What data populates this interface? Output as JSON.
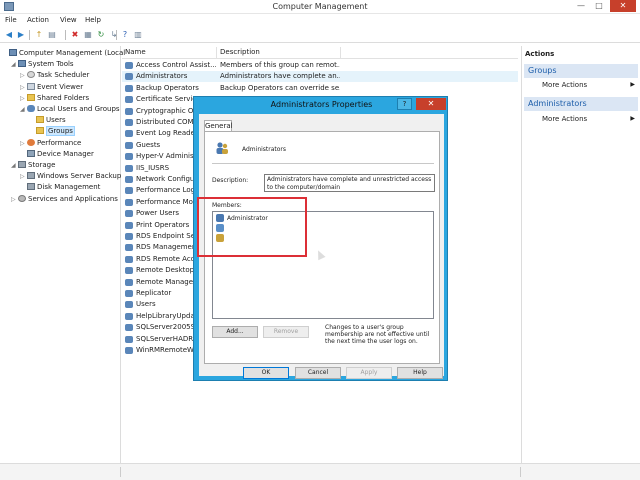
{
  "window": {
    "title": "Computer Management",
    "minimize": "—",
    "maximize": "□",
    "close": "✕"
  },
  "menu": [
    "File",
    "Action",
    "View",
    "Help"
  ],
  "toolbar": {
    "icons": [
      "back-arrow-icon",
      "forward-arrow-icon",
      "up-folder-icon",
      "show-hide-tree-icon",
      "delete-icon",
      "properties-icon",
      "refresh-icon",
      "export-list-icon",
      "help-icon",
      "show-hide-action-pane-icon"
    ],
    "glyphs": [
      "◀",
      "▶",
      "↑",
      "▤",
      "✖",
      "▦",
      "↻",
      "↳",
      "?",
      "▥"
    ],
    "colors": [
      "#2c7fc7",
      "#2c7fc7",
      "#c79a2c",
      "#6b7f94",
      "#d12a2a",
      "#6b7f94",
      "#2c8b3c",
      "#6b7f94",
      "#2c5fb3",
      "#6b7f94"
    ]
  },
  "tree": [
    {
      "label": "Computer Management (Local",
      "icon": "computer-icon",
      "cls": "ico-comp",
      "exp": "",
      "level": 0
    },
    {
      "label": "System Tools",
      "icon": "tools-icon",
      "cls": "ico-comp",
      "exp": "◢",
      "level": 1
    },
    {
      "label": "Task Scheduler",
      "icon": "task-scheduler-icon",
      "cls": "ico-clock",
      "exp": "▷",
      "level": 2
    },
    {
      "label": "Event Viewer",
      "icon": "event-viewer-icon",
      "cls": "ico-log",
      "exp": "▷",
      "level": 2
    },
    {
      "label": "Shared Folders",
      "icon": "shared-folders-icon",
      "cls": "ico-folder",
      "exp": "▷",
      "level": 2
    },
    {
      "label": "Local Users and Groups",
      "icon": "users-groups-icon",
      "cls": "ico-users",
      "exp": "◢",
      "level": 2
    },
    {
      "label": "Users",
      "icon": "folder-icon",
      "cls": "ico-folder",
      "exp": "",
      "level": 3
    },
    {
      "label": "Groups",
      "icon": "folder-icon",
      "cls": "ico-folder",
      "exp": "",
      "level": 3,
      "selected": true
    },
    {
      "label": "Performance",
      "icon": "performance-icon",
      "cls": "ico-perf",
      "exp": "▷",
      "level": 2
    },
    {
      "label": "Device Manager",
      "icon": "device-manager-icon",
      "cls": "ico-dev",
      "exp": "",
      "level": 2
    },
    {
      "label": "Storage",
      "icon": "storage-icon",
      "cls": "ico-disk",
      "exp": "◢",
      "level": 1
    },
    {
      "label": "Windows Server Backup",
      "icon": "backup-icon",
      "cls": "ico-disk",
      "exp": "▷",
      "level": 2
    },
    {
      "label": "Disk Management",
      "icon": "disk-management-icon",
      "cls": "ico-disk",
      "exp": "",
      "level": 2
    },
    {
      "label": "Services and Applications",
      "icon": "services-icon",
      "cls": "ico-svc",
      "exp": "▷",
      "level": 1
    }
  ],
  "columns": {
    "name": "Name",
    "description": "Description"
  },
  "groups": [
    {
      "name": "Access Control Assist...",
      "desc": "Members of this group can remot..."
    },
    {
      "name": "Administrators",
      "desc": "Administrators have complete an...",
      "selected": true
    },
    {
      "name": "Backup Operators",
      "desc": "Backup Operators can override se..."
    },
    {
      "name": "Certificate Servic",
      "desc": ""
    },
    {
      "name": "Cryptographic Op",
      "desc": ""
    },
    {
      "name": "Distributed COM",
      "desc": ""
    },
    {
      "name": "Event Log Reade",
      "desc": ""
    },
    {
      "name": "Guests",
      "desc": ""
    },
    {
      "name": "Hyper-V Adminis",
      "desc": ""
    },
    {
      "name": "IIS_IUSRS",
      "desc": ""
    },
    {
      "name": "Network Configu",
      "desc": ""
    },
    {
      "name": "Performance Log",
      "desc": ""
    },
    {
      "name": "Performance Mo",
      "desc": ""
    },
    {
      "name": "Power Users",
      "desc": ""
    },
    {
      "name": "Print Operators",
      "desc": ""
    },
    {
      "name": "RDS Endpoint Se",
      "desc": ""
    },
    {
      "name": "RDS Managemen",
      "desc": ""
    },
    {
      "name": "RDS Remote Acc",
      "desc": ""
    },
    {
      "name": "Remote Desktop",
      "desc": ""
    },
    {
      "name": "Remote Manage",
      "desc": ""
    },
    {
      "name": "Replicator",
      "desc": ""
    },
    {
      "name": "Users",
      "desc": ""
    },
    {
      "name": "HelpLibraryUpda",
      "desc": ""
    },
    {
      "name": "SQLServer2005SC",
      "desc": ""
    },
    {
      "name": "SQLServerHADRU",
      "desc": ""
    },
    {
      "name": "WinRMRemoteW",
      "desc": ""
    }
  ],
  "actions": {
    "header": "Actions",
    "sections": [
      {
        "title": "Groups",
        "item": "More Actions"
      },
      {
        "title": "Administrators",
        "item": "More Actions"
      }
    ]
  },
  "dialog": {
    "title": "Administrators Properties",
    "help": "?",
    "close": "✕",
    "tab": "General",
    "group_name": "Administrators",
    "description_label": "Description:",
    "description_value": "Administrators have complete and unrestricted access to the computer/domain",
    "members_label": "Members:",
    "members": [
      {
        "name": "Administrator",
        "icon": "user-icon",
        "color": "#4a78b0"
      },
      {
        "name": "",
        "icon": "user-icon",
        "color": "#5a8fc8"
      },
      {
        "name": "",
        "icon": "group-icon",
        "color": "#c9a23a"
      }
    ],
    "add_button": "Add...",
    "remove_button": "Remove",
    "note": "Changes to a user's group membership are not effective until the next time the user logs on.",
    "ok_button": "OK",
    "cancel_button": "Cancel",
    "apply_button": "Apply",
    "help_button": "Help"
  },
  "colors": {
    "dialog_frame": "#2ba6df",
    "highlight": "#dc2f36",
    "selection": "#cde8ff",
    "actions_section": "#dbe6f4"
  }
}
